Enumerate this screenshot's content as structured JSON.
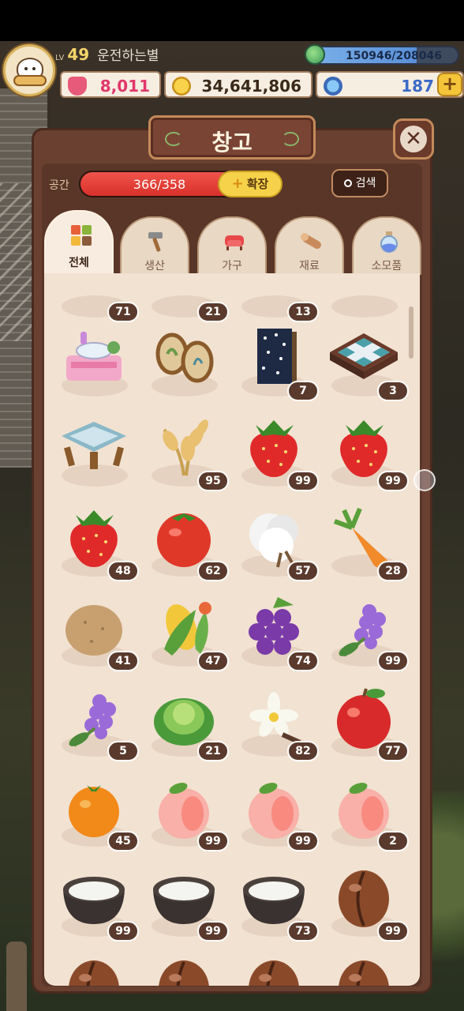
{
  "hud": {
    "level_label": "LV",
    "level": "49",
    "nickname": "운전하는별",
    "xp_text": "150946/208046",
    "xp_progress": 0.7255,
    "hearts": "8,011",
    "gold": "34,641,806",
    "gems": "187",
    "add_label": "+"
  },
  "panel": {
    "title": "창고",
    "close_label": "✕",
    "space_label": "공간",
    "capacity_text": "366/358",
    "capacity_fill": 1.0,
    "expand_plus": "+",
    "expand_label": "확장",
    "search_label": "검색"
  },
  "tabs": [
    {
      "label": "전체",
      "icon": "grid-icon",
      "active": true
    },
    {
      "label": "생산",
      "icon": "hammer-icon",
      "active": false
    },
    {
      "label": "가구",
      "icon": "sofa-icon",
      "active": false
    },
    {
      "label": "재료",
      "icon": "log-icon",
      "active": false
    },
    {
      "label": "소모품",
      "icon": "potion-icon",
      "active": false
    }
  ],
  "items": [
    {
      "icon": "partial-item-icon",
      "count": "71"
    },
    {
      "icon": "partial-item-icon",
      "count": "21"
    },
    {
      "icon": "partial-item-icon",
      "count": "13"
    },
    {
      "icon": "partial-item-icon",
      "count": ""
    },
    {
      "icon": "vanity-table-icon",
      "count": ""
    },
    {
      "icon": "mirror-frames-icon",
      "count": ""
    },
    {
      "icon": "dotted-panel-icon",
      "count": "7"
    },
    {
      "icon": "checkered-table-icon",
      "count": "3"
    },
    {
      "icon": "cushion-stool-icon",
      "count": ""
    },
    {
      "icon": "wheat-icon",
      "count": "95"
    },
    {
      "icon": "strawberry-icon",
      "count": "99"
    },
    {
      "icon": "strawberry-icon",
      "count": "99"
    },
    {
      "icon": "strawberry-icon",
      "count": "48"
    },
    {
      "icon": "tomato-icon",
      "count": "62"
    },
    {
      "icon": "cotton-icon",
      "count": "57"
    },
    {
      "icon": "carrot-icon",
      "count": "28"
    },
    {
      "icon": "potato-icon",
      "count": "41"
    },
    {
      "icon": "corn-icon",
      "count": "47"
    },
    {
      "icon": "grapes-icon",
      "count": "74"
    },
    {
      "icon": "lilac-icon",
      "count": "99"
    },
    {
      "icon": "lilac-icon",
      "count": "5"
    },
    {
      "icon": "lettuce-icon",
      "count": "21"
    },
    {
      "icon": "vanilla-flower-icon",
      "count": "82"
    },
    {
      "icon": "apple-icon",
      "count": "77"
    },
    {
      "icon": "orange-icon",
      "count": "45"
    },
    {
      "icon": "peach-icon",
      "count": "99"
    },
    {
      "icon": "peach-icon",
      "count": "99"
    },
    {
      "icon": "peach-icon",
      "count": "2"
    },
    {
      "icon": "milk-bowl-icon",
      "count": "99"
    },
    {
      "icon": "milk-bowl-icon",
      "count": "99"
    },
    {
      "icon": "milk-bowl-icon",
      "count": "73"
    },
    {
      "icon": "coffee-bean-icon",
      "count": "99"
    },
    {
      "icon": "coffee-bean-icon",
      "count": ""
    },
    {
      "icon": "coffee-bean-icon",
      "count": ""
    },
    {
      "icon": "coffee-bean-icon",
      "count": ""
    },
    {
      "icon": "coffee-bean-icon",
      "count": ""
    }
  ],
  "colors": {
    "panel": "#6a4030",
    "grid_bg": "#f2e2d2",
    "count_badge": "#5a3a2c",
    "capacity_red": "#d8302a",
    "expand_yellow": "#f6d24a"
  }
}
